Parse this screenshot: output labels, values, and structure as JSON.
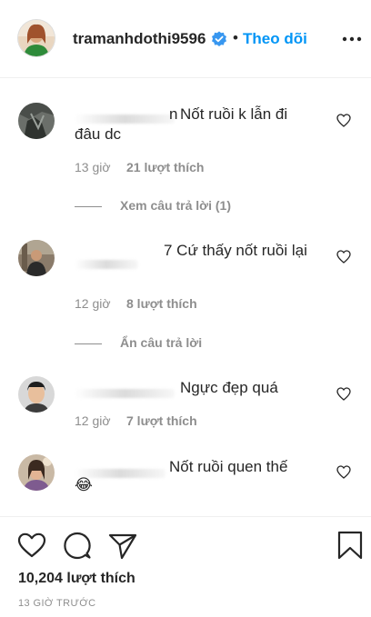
{
  "header": {
    "username": "tramanhdothi9596",
    "separator": "•",
    "follow_label": "Theo dõi",
    "avatar_icon": "profile-avatar",
    "verified_icon": "verified-badge-icon",
    "more_icon": "more-options-icon",
    "accent": "#0095f6"
  },
  "comments": [
    {
      "text_line1": "Nốt ruồi k lẫn đi",
      "text_line2": "đâu dc",
      "prefix_char": "n",
      "time": "13 giờ",
      "likes": "21 lượt thích",
      "replies_label": "Xem câu trả lời (1)"
    },
    {
      "text_line1": "7 Cứ thấy nốt ruồi lại",
      "time": "12 giờ",
      "likes": "8 lượt thích",
      "replies_label": "Ẩn câu trả lời"
    },
    {
      "text_line1": "Ngực đẹp quá",
      "time": "12 giờ",
      "likes": "7 lượt thích"
    },
    {
      "text_line1": "Nốt ruồi quen thế",
      "emoji": "😂"
    }
  ],
  "footer": {
    "likes": "10,204 lượt thích",
    "time_ago": "13 GIỜ TRƯỚC",
    "icons": [
      "heart-icon",
      "comment-icon",
      "share-icon",
      "bookmark-icon"
    ]
  }
}
